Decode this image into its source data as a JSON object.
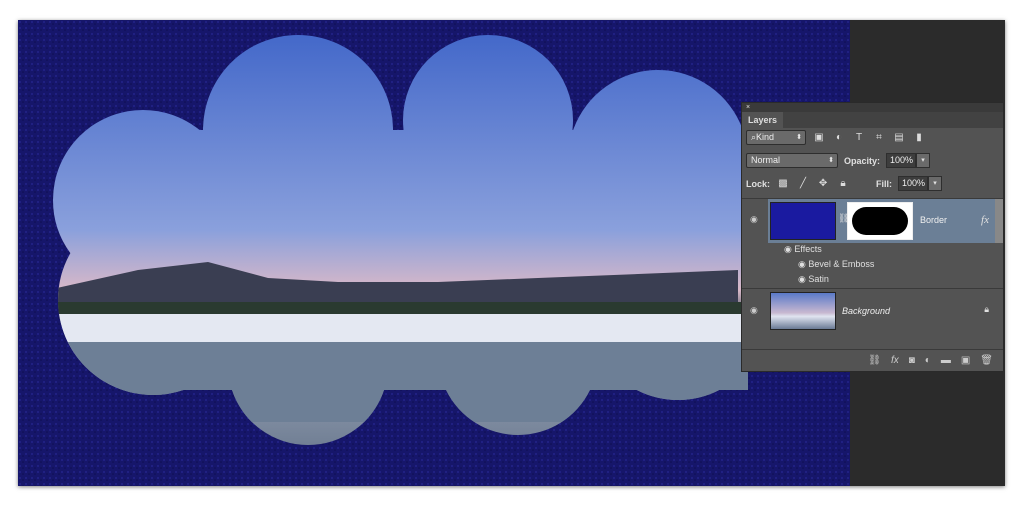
{
  "panel": {
    "close": "×",
    "tab": "Layers",
    "filter_kind": "Kind",
    "blend_mode": "Normal",
    "opacity_label": "Opacity:",
    "opacity_value": "100%",
    "lock_label": "Lock:",
    "fill_label": "Fill:",
    "fill_value": "100%",
    "layers": [
      {
        "name": "Border",
        "fx": "fx",
        "color": "#1a1aa0",
        "effects_label": "Effects",
        "effects": [
          "Bevel & Emboss",
          "Satin"
        ]
      },
      {
        "name": "Background",
        "locked": true
      }
    ]
  },
  "colors": {
    "border": "#16166a",
    "panel": "#535353",
    "selected_layer": "#6b7f96"
  }
}
